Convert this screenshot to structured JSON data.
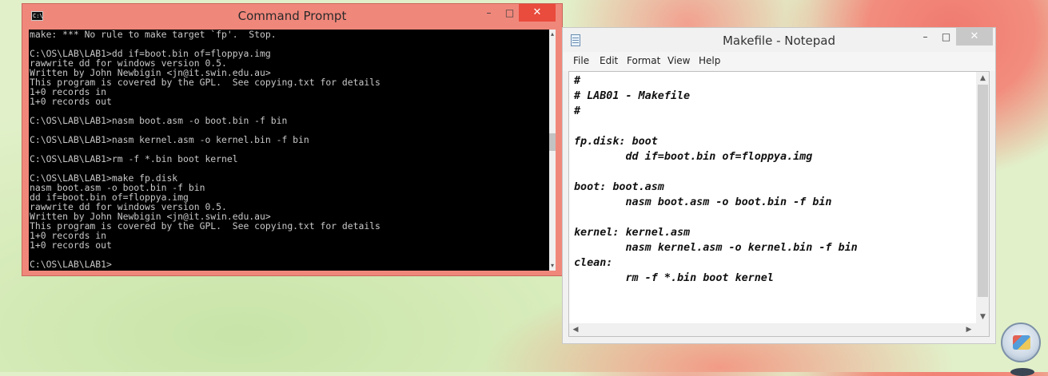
{
  "cmd": {
    "title": "Command Prompt",
    "app_icon": "C:\\",
    "controls": {
      "minimize": "–",
      "maximize": "□",
      "close": "✕"
    },
    "output": "make: *** No rule to make target `fp'.  Stop.\n\nC:\\OS\\LAB\\LAB1>dd if=boot.bin of=floppya.img\nrawwrite dd for windows version 0.5.\nWritten by John Newbigin <jn@it.swin.edu.au>\nThis program is covered by the GPL.  See copying.txt for details\n1+0 records in\n1+0 records out\n\nC:\\OS\\LAB\\LAB1>nasm boot.asm -o boot.bin -f bin\n\nC:\\OS\\LAB\\LAB1>nasm kernel.asm -o kernel.bin -f bin\n\nC:\\OS\\LAB\\LAB1>rm -f *.bin boot kernel\n\nC:\\OS\\LAB\\LAB1>make fp.disk\nnasm boot.asm -o boot.bin -f bin\ndd if=boot.bin of=floppya.img\nrawwrite dd for windows version 0.5.\nWritten by John Newbigin <jn@it.swin.edu.au>\nThis program is covered by the GPL.  See copying.txt for details\n1+0 records in\n1+0 records out\n\nC:\\OS\\LAB\\LAB1>"
  },
  "notepad": {
    "title": "Makefile - Notepad",
    "controls": {
      "minimize": "–",
      "maximize": "□",
      "close": "✕"
    },
    "menu": [
      "File",
      "Edit",
      "Format",
      "View",
      "Help"
    ],
    "content": "#\n# LAB01 - Makefile\n#\n\nfp.disk: boot\n        dd if=boot.bin of=floppya.img\n\nboot: boot.asm\n        nasm boot.asm -o boot.bin -f bin\n\nkernel: kernel.asm\n        nasm kernel.asm -o kernel.bin -f bin\nclean:\n        rm -f *.bin boot kernel"
  },
  "scroll_glyphs": {
    "up": "▲",
    "down": "▼",
    "left": "◀",
    "right": "▶",
    "cmd_up": "▴",
    "cmd_down": "▾"
  }
}
